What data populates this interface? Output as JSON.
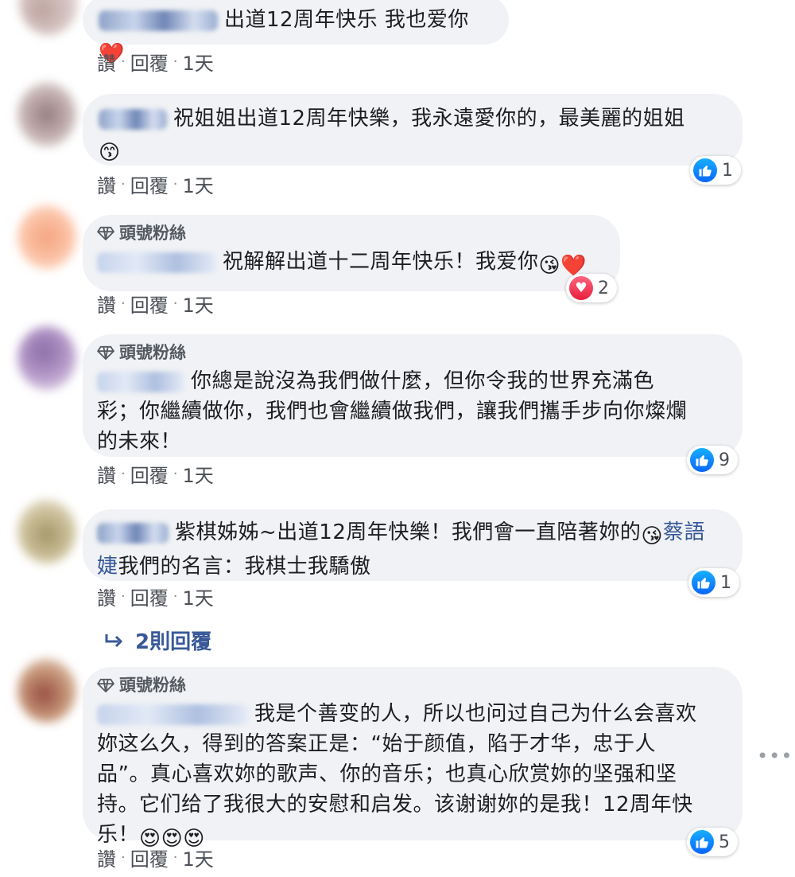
{
  "comments": [
    {
      "text": "出道12周年快乐 我也爱你",
      "emoji": "❤️",
      "actions": {
        "like": "讚",
        "reply": "回覆",
        "time": "1天"
      }
    },
    {
      "text": "祝姐姐出道12周年快樂，我永遠愛你的，最美麗的姐姐",
      "emoji": "😙",
      "actions": {
        "like": "讚",
        "reply": "回覆",
        "time": "1天"
      },
      "reaction": {
        "type": "like",
        "count": "1"
      }
    },
    {
      "badge": "頭號粉絲",
      "text": "祝解解出道十二周年快乐！我爱你",
      "emoji": "😘❤️",
      "actions": {
        "like": "讚",
        "reply": "回覆",
        "time": "1天"
      },
      "reaction": {
        "type": "love",
        "count": "2"
      }
    },
    {
      "badge": "頭號粉絲",
      "text_line1": "你總是說沒為我們做什麼，但你令我的世界充滿色",
      "text_line2": "彩；你繼續做你，我們也會繼續做我們，讓我們攜手步向你燦爛",
      "text_line3": "的未來！",
      "actions": {
        "like": "讚",
        "reply": "回覆",
        "time": "1天"
      },
      "reaction": {
        "type": "like",
        "count": "9"
      }
    },
    {
      "text_line1": "紫棋姊姊~出道12周年快樂！我們會一直陪著妳的",
      "emoji": "😘",
      "mention_part1": "蔡語",
      "mention_part2": "婕",
      "text_line2": "我們的名言：我棋士我驕傲",
      "actions": {
        "like": "讚",
        "reply": "回覆",
        "time": "1天"
      },
      "reaction": {
        "type": "like",
        "count": "1"
      }
    },
    {
      "badge": "頭號粉絲",
      "text_line1": "我是个善变的人，所以也问过自己为什么会喜欢",
      "text_line2": "妳这么久，得到的答案正是：“始于颜值，陷于才华，忠于人",
      "text_line3": "品”。真心喜欢妳的歌声、你的音乐；也真心欣赏妳的坚强和坚",
      "text_line4": "持。它们给了我很大的安慰和启发。该谢谢妳的是我！12周年快",
      "text_line5": "乐！",
      "emoji": "😍😍😍",
      "actions": {
        "like": "讚",
        "reply": "回覆",
        "time": "1天"
      },
      "reaction": {
        "type": "like",
        "count": "5"
      }
    }
  ],
  "replies_link": "2則回覆",
  "more_icon": "•••",
  "colors": {
    "bubble": "#f0f2f5",
    "link": "#365899",
    "like": "#0866ff",
    "love": "#e61e3c"
  }
}
